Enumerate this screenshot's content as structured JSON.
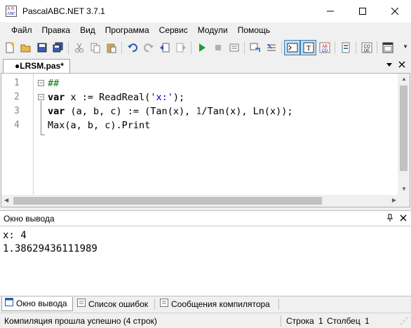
{
  "window": {
    "title": "PascalABC.NET 3.7.1"
  },
  "menu": [
    "Файл",
    "Правка",
    "Вид",
    "Программа",
    "Сервис",
    "Модули",
    "Помощь"
  ],
  "toolbar": {
    "icons": [
      "new-file-icon",
      "open-file-icon",
      "save-icon",
      "save-all-icon",
      "cut-icon",
      "copy-icon",
      "paste-icon",
      "undo-icon",
      "redo-icon",
      "back-icon",
      "forward-icon",
      "run-icon",
      "stop-icon",
      "debug-icon",
      "step-into-icon",
      "step-over-icon",
      "console-icon",
      "text-icon",
      "format-icon",
      "compile-icon",
      "code-icon",
      "form-icon"
    ]
  },
  "editor": {
    "tab_label": "●LRSM.pas*",
    "line_numbers": [
      "1",
      "2",
      "3",
      "4"
    ],
    "lines": [
      [
        {
          "t": "##",
          "c": "cm"
        }
      ],
      [
        {
          "t": "var",
          "c": "kw"
        },
        {
          "t": " x := ReadReal(",
          "c": ""
        },
        {
          "t": "'x:'",
          "c": "str"
        },
        {
          "t": ");",
          "c": ""
        }
      ],
      [
        {
          "t": "var",
          "c": "kw"
        },
        {
          "t": " (a, b, c) := (Tan(x), ",
          "c": ""
        },
        {
          "t": "1",
          "c": "num"
        },
        {
          "t": "/Tan(x), Ln(x));",
          "c": ""
        }
      ],
      [
        {
          "t": "Max(a, b, c).Print",
          "c": ""
        }
      ]
    ]
  },
  "output_panel": {
    "title": "Окно вывода",
    "lines": [
      "x: 4",
      "1.38629436111989"
    ]
  },
  "bottom_tabs": [
    "Окно вывода",
    "Список ошибок",
    "Сообщения компилятора"
  ],
  "status": {
    "message": "Компиляция прошла успешно (4 строк)",
    "row_label": "Строка",
    "row_value": "1",
    "col_label": "Столбец",
    "col_value": "1"
  }
}
